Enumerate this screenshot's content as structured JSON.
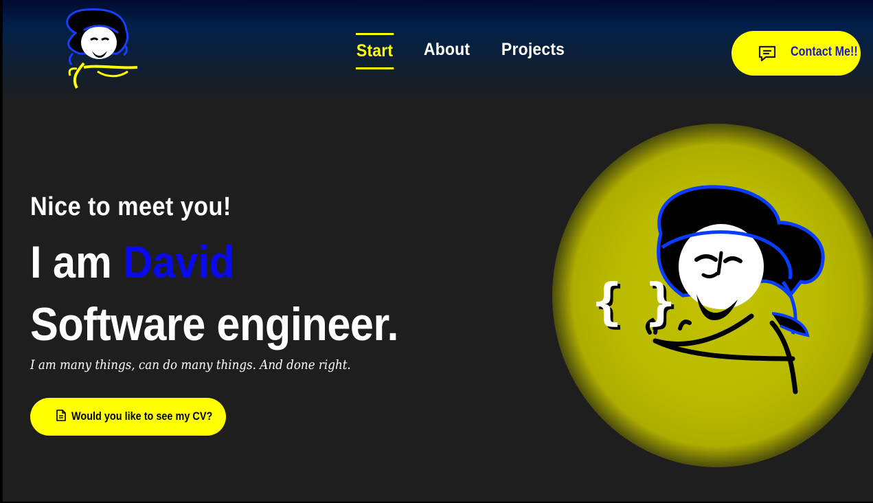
{
  "nav": {
    "items": [
      {
        "label": "Start",
        "active": true
      },
      {
        "label": "About",
        "active": false
      },
      {
        "label": "Projects",
        "active": false
      }
    ]
  },
  "contact": {
    "label": "Contact Me!!",
    "icon": "chat-icon"
  },
  "hero": {
    "greeting": "Nice to meet you!",
    "intro_prefix": "I am ",
    "name": "David",
    "role": "Software engineer.",
    "tagline": "I am many things, can do many things. And done right."
  },
  "cv_button": {
    "label": "Would you like to see my CV?",
    "icon": "document-icon"
  },
  "colors": {
    "accent": "#ffff00",
    "name": "#0a0aee",
    "background": "#1e1e1e",
    "header": "#001a3c"
  }
}
